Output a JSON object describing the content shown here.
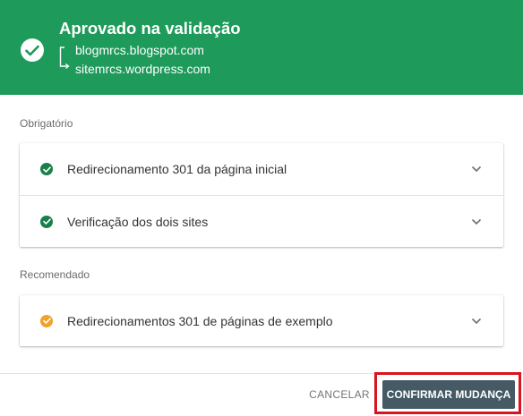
{
  "header": {
    "title": "Aprovado na validação",
    "source_site": "blogmrcs.blogspot.com",
    "destination_site": "sitemrcs.wordpress.com",
    "background_color": "#1e9a5a"
  },
  "sections": {
    "required": {
      "label": "Obrigatório",
      "items": [
        {
          "label": "Redirecionamento 301 da página inicial",
          "status": "passed",
          "icon": "check-circle-icon"
        },
        {
          "label": "Verificação dos dois sites",
          "status": "passed",
          "icon": "check-circle-icon"
        }
      ]
    },
    "recommended": {
      "label": "Recomendado",
      "items": [
        {
          "label": "Redirecionamentos 301 de páginas de exemplo",
          "status": "warning",
          "icon": "check-circle-icon"
        }
      ]
    }
  },
  "footer": {
    "cancel_label": "CANCELAR",
    "confirm_label": "CONFIRMAR MUDANÇA",
    "highlight_color": "#d9141e"
  }
}
